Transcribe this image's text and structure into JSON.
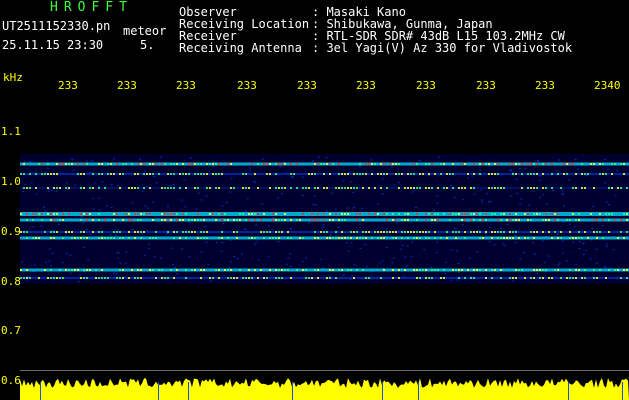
{
  "header": {
    "title": "HROFFT",
    "filename": "UT2511152330.pn",
    "mode": "meteor",
    "datetime": "25.11.15 23:30",
    "count": "5."
  },
  "info": [
    {
      "label": "Observer",
      "value": ": Masaki Kano"
    },
    {
      "label": "Receiving Location",
      "value": ": Shibukawa, Gunma, Japan"
    },
    {
      "label": "Receiver",
      "value": ": RTL-SDR SDR# 43dB L15 103.2MHz CW"
    },
    {
      "label": "Receiving Antenna",
      "value": ": 3el Yagi(V) Az 330 for Vladivostok"
    }
  ],
  "axis": {
    "unit": "kHz",
    "y_ticks": [
      "1.1",
      "1.0",
      "0.9",
      "0.8",
      "0.7",
      "0.6"
    ],
    "x_ticks": [
      "233",
      "233",
      "233",
      "233",
      "233",
      "233",
      "233",
      "233",
      "233",
      "2340"
    ]
  },
  "colors": {
    "background": "#000000",
    "text_green": "#3cff3c",
    "text_yellow": "#ffff00",
    "text_white": "#ffffff",
    "noise_low": "#000050",
    "noise_mid": "#0030c0",
    "band": "#00e0ff",
    "peak": "#ff2a20",
    "power": "#ffff00"
  }
}
